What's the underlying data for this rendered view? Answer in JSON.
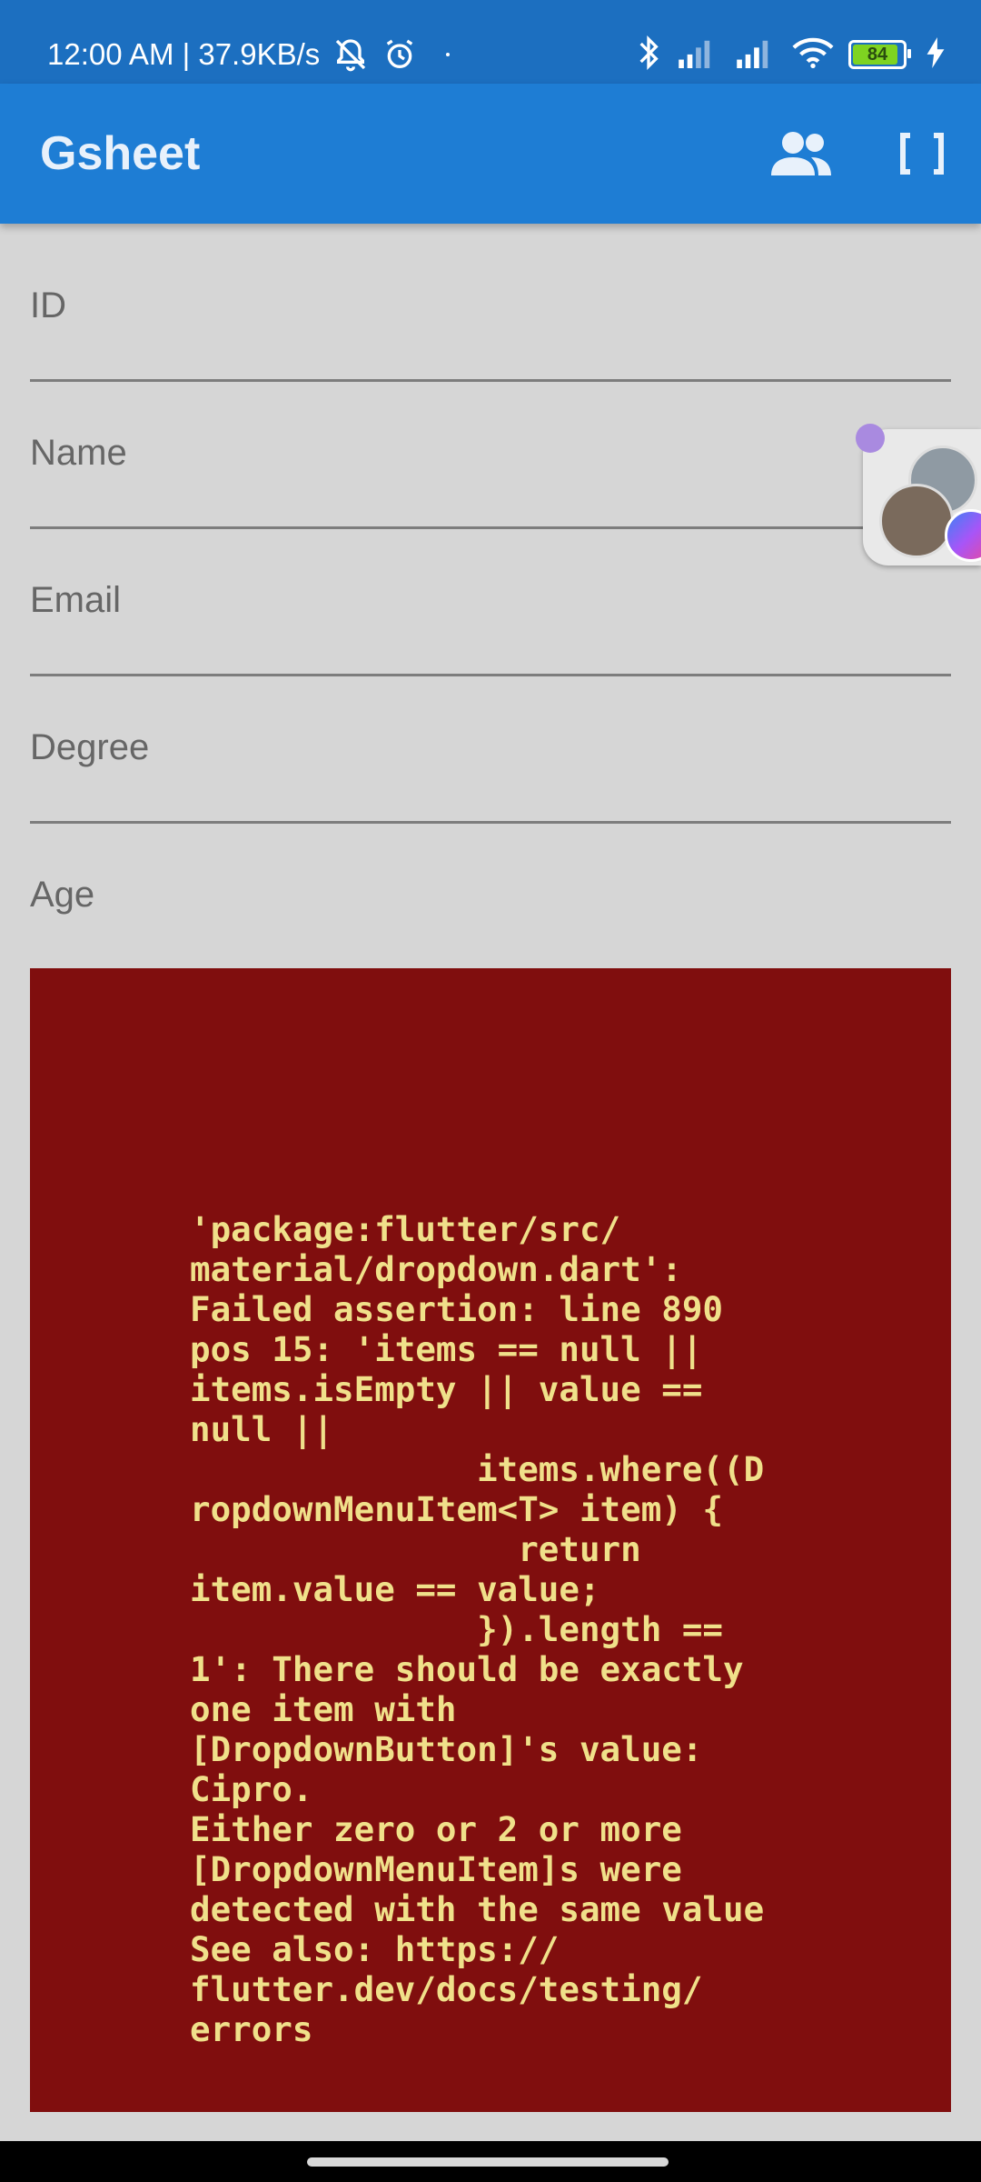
{
  "status_bar": {
    "time_speed": "12:00 AM | 37.9KB/s",
    "battery_level": "84",
    "icons": [
      "mute-bell-icon",
      "alarm-icon",
      "bluetooth-icon",
      "signal-icon",
      "signal-icon",
      "wifi-icon",
      "battery-icon",
      "charging-icon"
    ]
  },
  "app_bar": {
    "title": "Gsheet",
    "actions": [
      "people-icon",
      "brackets-icon"
    ]
  },
  "form": {
    "fields": [
      {
        "label": "ID"
      },
      {
        "label": "Name"
      },
      {
        "label": "Email"
      },
      {
        "label": "Degree"
      },
      {
        "label": "Age"
      }
    ]
  },
  "error": {
    "message": "'package:flutter/src/\nmaterial/dropdown.dart':\nFailed assertion: line 890\npos 15: 'items == null ||\nitems.isEmpty || value ==\nnull ||\n              items.where((D\nropdownMenuItem<T> item) {\n                return\nitem.value == value;\n              }).length ==\n1': There should be exactly\none item with\n[DropdownButton]'s value:\nCipro.\nEither zero or 2 or more\n[DropdownMenuItem]s were\ndetected with the same value\nSee also: https://\nflutter.dev/docs/testing/\nerrors"
  },
  "colors": {
    "app_bar": "#1e7dd4",
    "status_bar": "#1c6fc0",
    "error_background": "#800e0e",
    "error_text": "#f0e08a",
    "page_background": "#d6d6d6"
  }
}
